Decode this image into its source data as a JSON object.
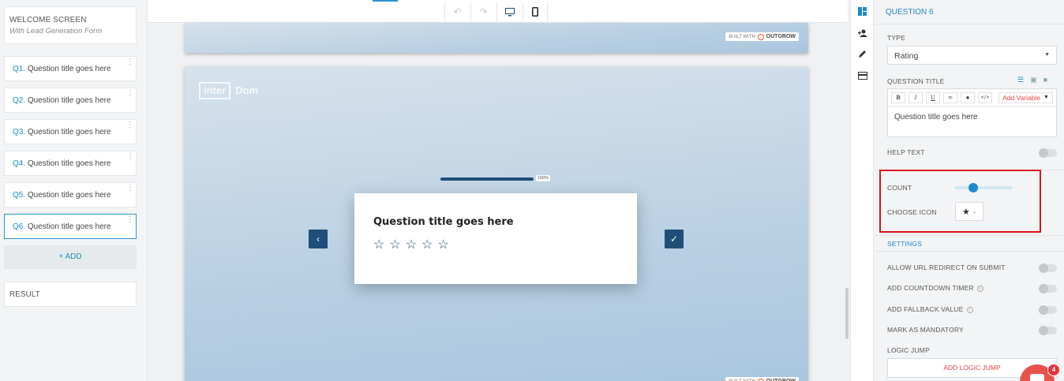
{
  "sidebar": {
    "welcome_title": "WELCOME SCREEN",
    "welcome_subtitle": "With Lead Generation Form",
    "questions": [
      {
        "num": "Q1.",
        "label": " Question title goes here"
      },
      {
        "num": "Q2.",
        "label": " Question title goes here"
      },
      {
        "num": "Q3.",
        "label": " Question title goes here"
      },
      {
        "num": "Q4.",
        "label": " Question title goes here"
      },
      {
        "num": "Q5.",
        "label": " Question title goes here"
      },
      {
        "num": "Q6.",
        "label": " Question title goes here"
      }
    ],
    "add_label": "+ ADD",
    "result_label": "RESULT"
  },
  "toolbar": {
    "undo_icon": "undo-icon",
    "redo_icon": "redo-icon",
    "desktop_icon": "desktop-icon",
    "mobile_icon": "mobile-icon"
  },
  "preview": {
    "built_with": "BUILT WITH",
    "brand": "OUTGROW",
    "logo_part1": "inter",
    "logo_part2": "Dom",
    "progress_label": "100%",
    "progress": 1.0,
    "question_title": "Question title goes here",
    "rating_count": 5,
    "star": "☆"
  },
  "panel": {
    "header": "QUESTION 6",
    "type_label": "TYPE",
    "type_value": "Rating",
    "question_title_label": "QUESTION TITLE",
    "add_variable": "Add Variable",
    "question_text": "Question title goes here",
    "help_text_label": "HELP TEXT",
    "count_label": "COUNT",
    "choose_icon_label": "CHOOSE ICON",
    "chosen_icon": "★",
    "settings_label": "SETTINGS",
    "settings": [
      {
        "label": "ALLOW URL REDIRECT ON SUBMIT",
        "info": false
      },
      {
        "label": "ADD COUNTDOWN TIMER",
        "info": true
      },
      {
        "label": "ADD FALLBACK VALUE",
        "info": true
      },
      {
        "label": "MARK AS MANDATORY",
        "info": false
      }
    ],
    "logic_jump_label": "LOGIC JUMP",
    "add_logic_jump": "ADD LOGIC JUMP"
  },
  "chat": {
    "badge_count": "4"
  },
  "colors": {
    "accent": "#1e8ac8",
    "brand_dark": "#1f4f78",
    "highlight": "#d9141a",
    "link_red": "#e24545"
  }
}
